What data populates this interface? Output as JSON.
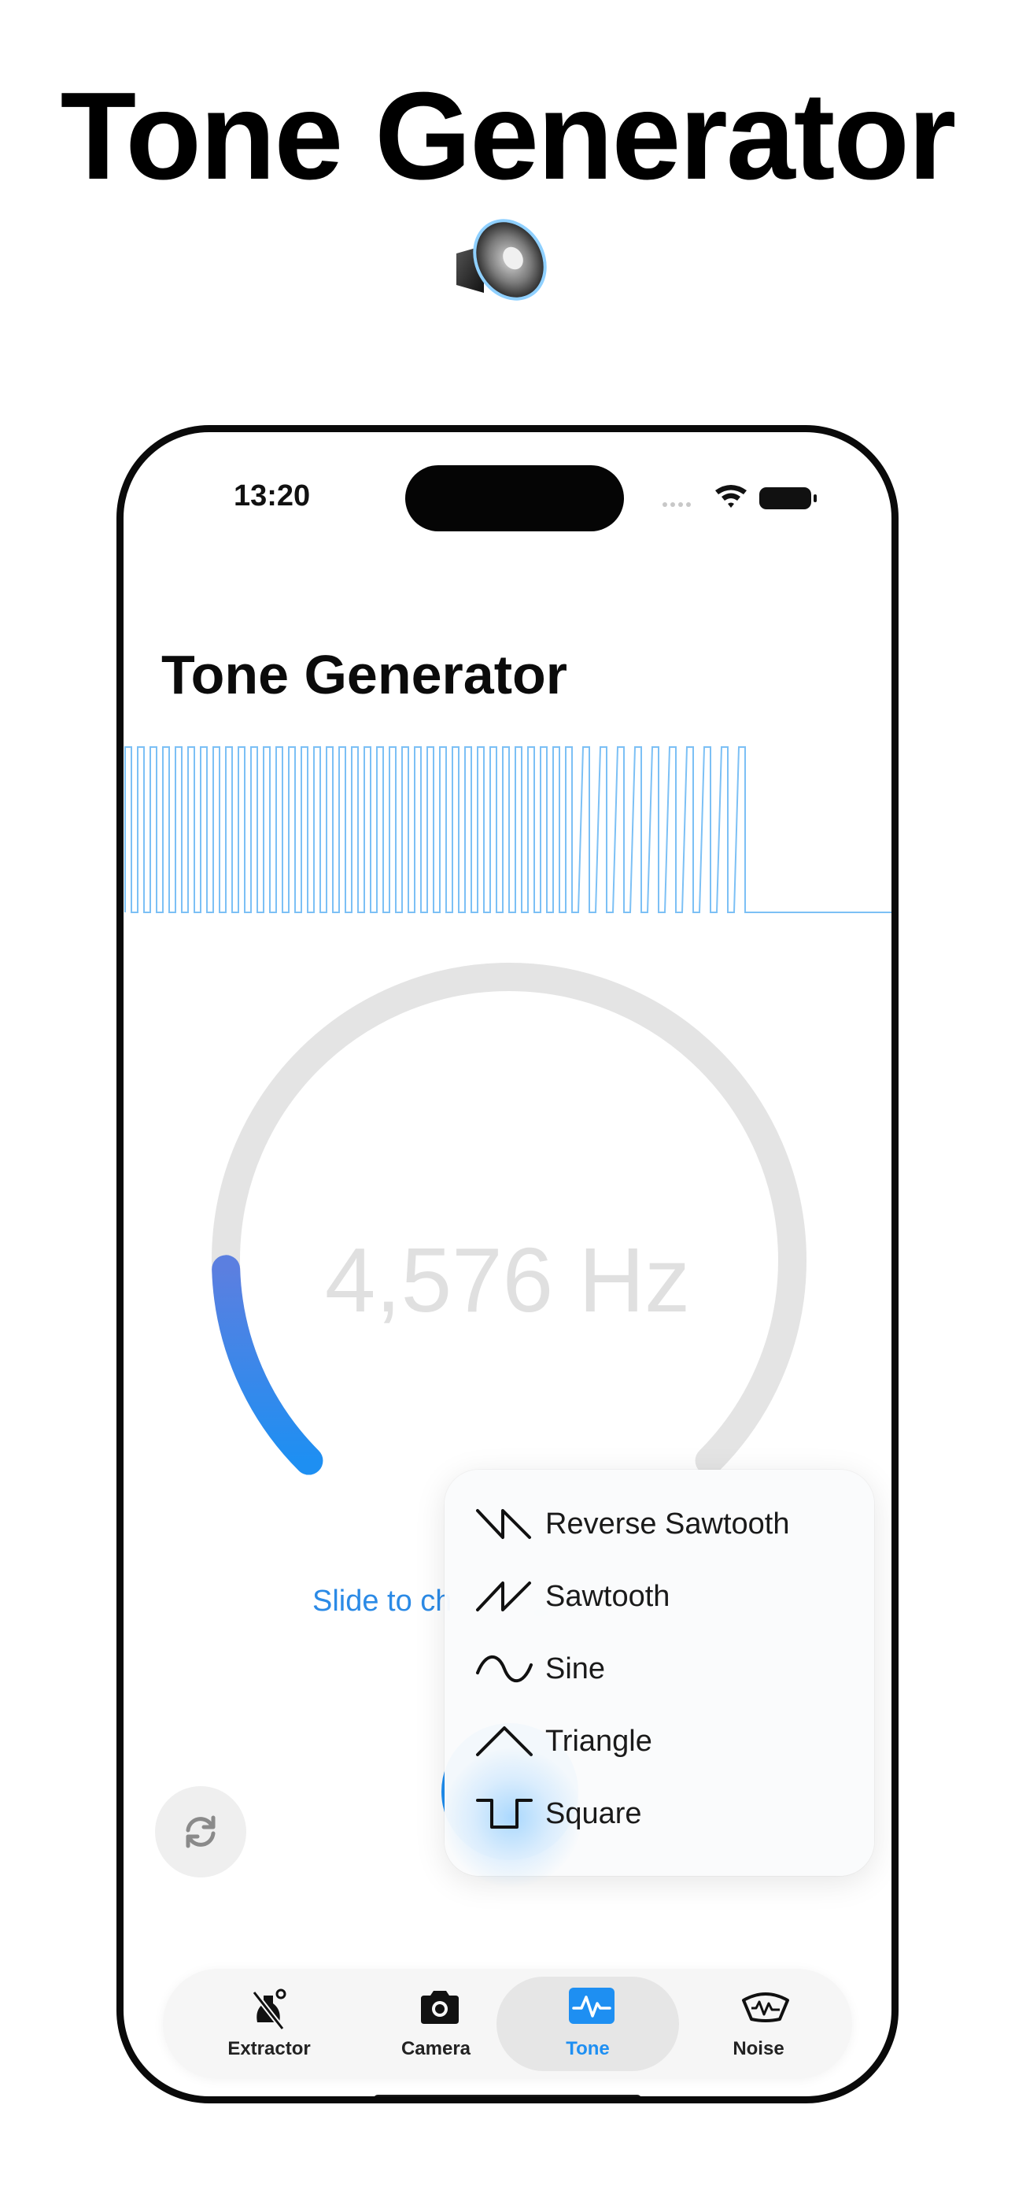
{
  "promo": {
    "title": "Tone Generator"
  },
  "status_bar": {
    "time": "13:20"
  },
  "screen": {
    "title": "Tone Generator",
    "frequency": "4,576 Hz",
    "dial_level": 0.16,
    "slide_hint": "Slide to ch"
  },
  "waveform_menu": {
    "items": [
      {
        "label": "Reverse Sawtooth",
        "icon": "reverse-sawtooth-wave-icon"
      },
      {
        "label": "Sawtooth",
        "icon": "sawtooth-wave-icon"
      },
      {
        "label": "Sine",
        "icon": "sine-wave-icon"
      },
      {
        "label": "Triangle",
        "icon": "triangle-wave-icon"
      },
      {
        "label": "Square",
        "icon": "square-wave-icon",
        "selected": true
      }
    ]
  },
  "tabs": [
    {
      "label": "Extractor",
      "icon": "extractor-icon"
    },
    {
      "label": "Camera",
      "icon": "camera-icon"
    },
    {
      "label": "Tone",
      "icon": "tone-wave-icon",
      "active": true
    },
    {
      "label": "Noise",
      "icon": "noise-icon"
    }
  ],
  "colors": {
    "accent": "#1E8FF2",
    "dial_track": "#E4E4E4",
    "frequency_text": "#E0E0E0"
  }
}
